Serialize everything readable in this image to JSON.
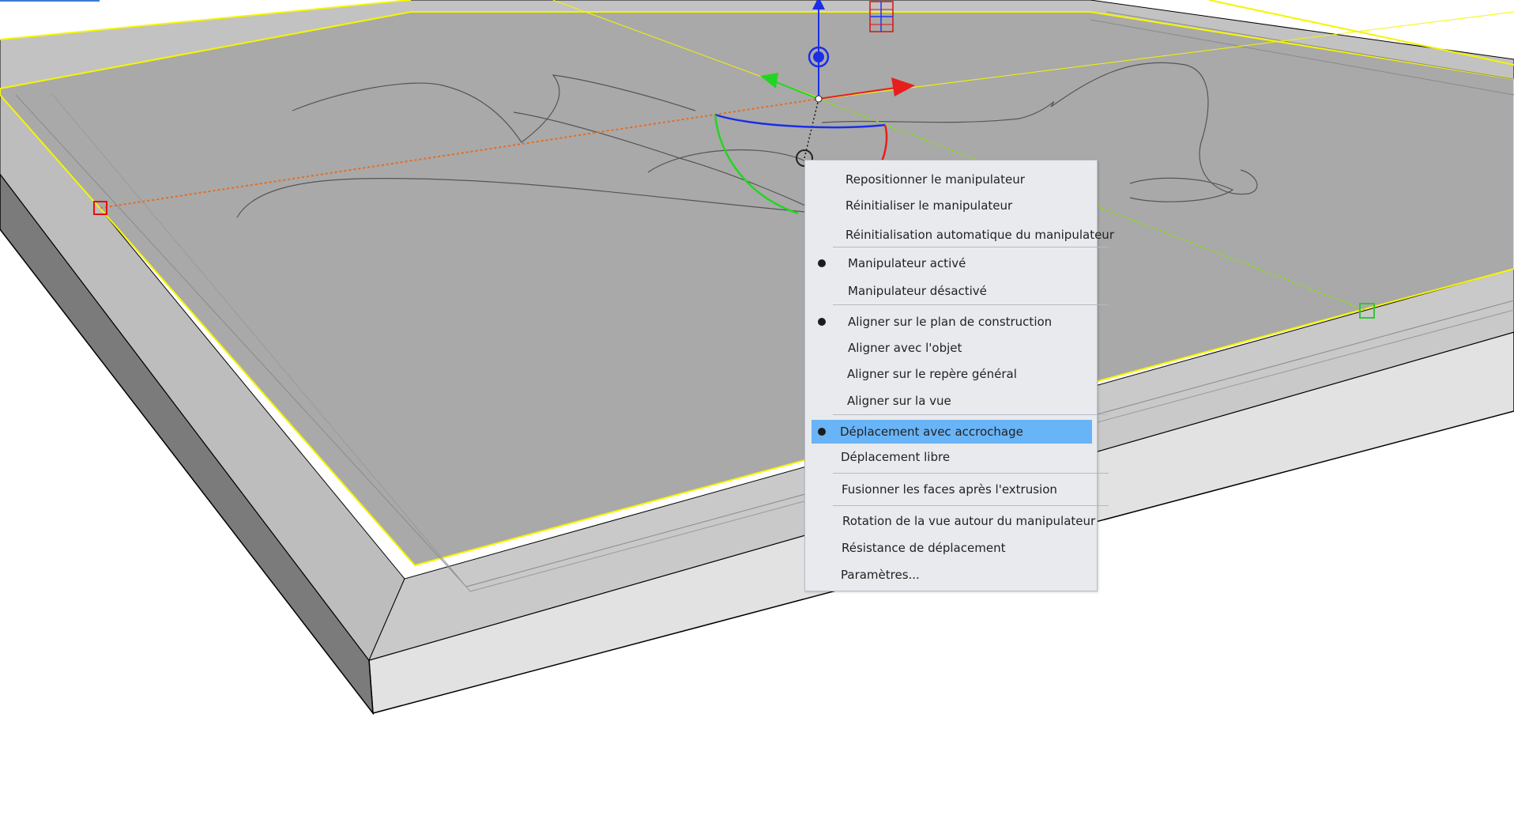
{
  "context_menu": {
    "items": [
      {
        "label": "Repositionner le manipulateur",
        "checked": false,
        "highlighted": false
      },
      {
        "label": "Réinitialiser le manipulateur",
        "checked": false,
        "highlighted": false
      },
      {
        "label": "Réinitialisation automatique du manipulateur",
        "checked": false,
        "highlighted": false
      },
      {
        "label": "Manipulateur activé",
        "checked": true,
        "highlighted": false
      },
      {
        "label": "Manipulateur désactivé",
        "checked": false,
        "highlighted": false
      },
      {
        "label": "Aligner sur le plan de construction",
        "checked": true,
        "highlighted": false
      },
      {
        "label": "Aligner avec l'objet",
        "checked": false,
        "highlighted": false
      },
      {
        "label": "Aligner sur le repère général",
        "checked": false,
        "highlighted": false
      },
      {
        "label": "Aligner sur la vue",
        "checked": false,
        "highlighted": false
      },
      {
        "label": "Déplacement avec accrochage",
        "checked": true,
        "highlighted": true
      },
      {
        "label": "Déplacement libre",
        "checked": false,
        "highlighted": false
      },
      {
        "label": "Fusionner les faces après l'extrusion",
        "checked": false,
        "highlighted": false
      },
      {
        "label": "Rotation de la vue autour du manipulateur",
        "checked": false,
        "highlighted": false
      },
      {
        "label": "Résistance de déplacement",
        "checked": false,
        "highlighted": false
      },
      {
        "label": "Paramètres...",
        "checked": false,
        "highlighted": false
      }
    ]
  },
  "colors": {
    "highlight": "#69b4f7",
    "selection_edge": "#f5f500",
    "axis_x": "#e81e1e",
    "axis_y": "#22d522",
    "axis_z": "#1a2ee8",
    "panel_top": "#a9a9a9",
    "panel_side_dark": "#7a7a7a",
    "panel_side_light": "#e3e3e3"
  },
  "icons": [
    "gumball-manipulator-icon",
    "snap-point-red-icon",
    "snap-point-green-icon",
    "cplane-grid-icon"
  ]
}
